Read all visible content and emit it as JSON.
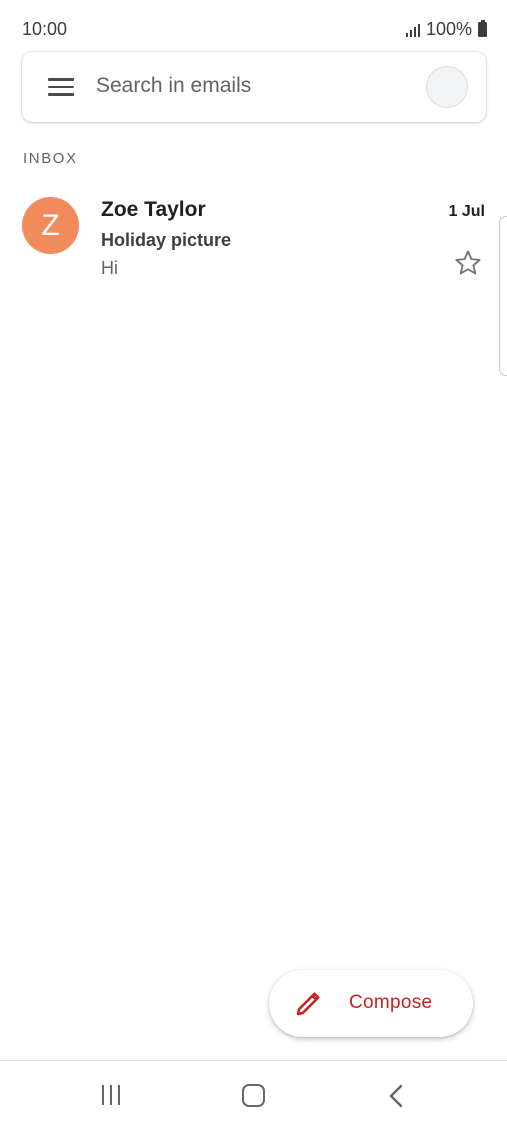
{
  "status_bar": {
    "time": "10:00",
    "battery": "100%",
    "icons": [
      "signal-icon",
      "battery-icon"
    ]
  },
  "search": {
    "placeholder": "Search in emails",
    "icons": [
      "menu-icon",
      "account-avatar"
    ]
  },
  "inbox": {
    "label": "INBOX",
    "emails": [
      {
        "avatar_letter": "Z",
        "avatar_color": "#f28b5b",
        "sender": "Zoe Taylor",
        "date": "1 Jul",
        "subject": "Holiday picture",
        "snippet": "Hi",
        "starred": false
      }
    ]
  },
  "compose": {
    "label": "Compose",
    "icon": "pencil-icon",
    "color": "#c5221f"
  },
  "nav_bar": {
    "icons": [
      "recents-icon",
      "home-icon",
      "back-icon"
    ]
  }
}
